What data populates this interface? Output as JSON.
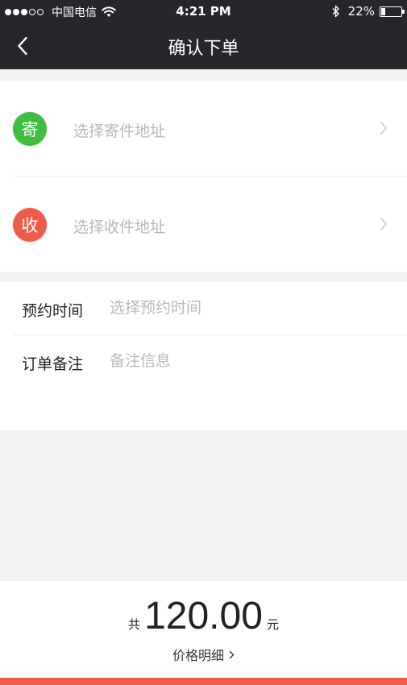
{
  "status_bar": {
    "carrier": "中国电信",
    "time": "4:21 PM",
    "battery": "22%",
    "battery_level": 0.22,
    "signal_bars": 3,
    "signal_total": 5
  },
  "nav": {
    "title": "确认下单",
    "back_icon": "chevron-left-icon"
  },
  "address": {
    "sender": {
      "badge": "寄",
      "placeholder": "选择寄件地址",
      "color": "#3fbf3f"
    },
    "receiver": {
      "badge": "收",
      "placeholder": "选择收件地址",
      "color": "#ef5d4a"
    }
  },
  "info": {
    "time": {
      "label": "预约时间",
      "placeholder": "选择预约时间"
    },
    "remark": {
      "label": "订单备注",
      "placeholder": "备注信息"
    }
  },
  "price": {
    "prefix": "共",
    "amount": "120.00",
    "suffix": "元",
    "detail_label": "价格明细"
  },
  "colors": {
    "header_bg": "#27272b",
    "accent": "#ef5d4a"
  }
}
